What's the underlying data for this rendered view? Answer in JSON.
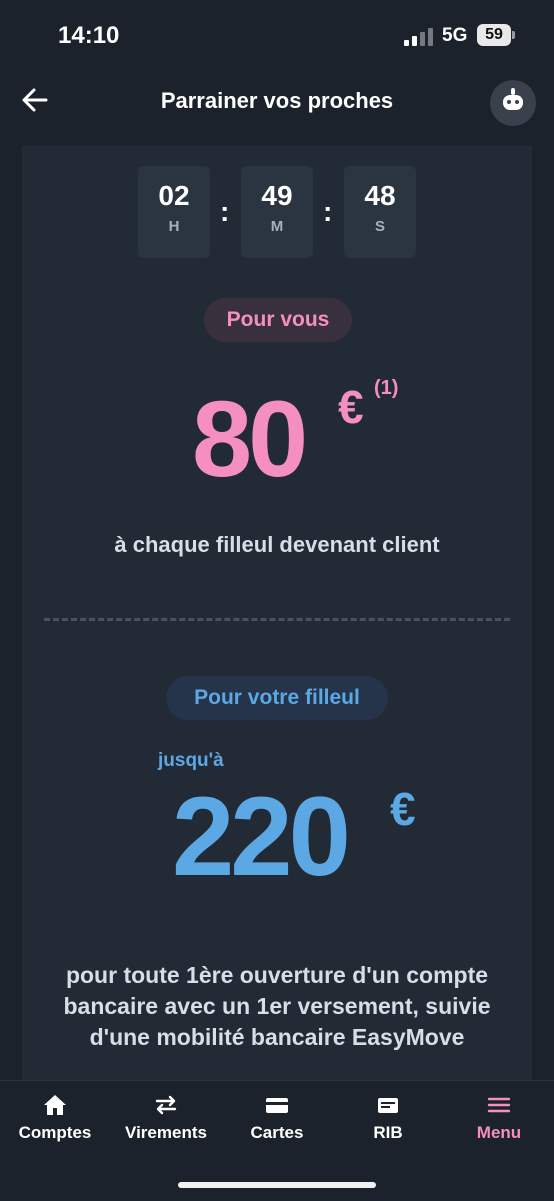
{
  "status_bar": {
    "time": "14:10",
    "network": "5G",
    "battery": "59"
  },
  "header": {
    "title": "Parrainer vos proches",
    "back_icon": "arrow-left-icon",
    "assistant_icon": "robot-icon"
  },
  "countdown": {
    "hours": {
      "value": "02",
      "unit": "H"
    },
    "minutes": {
      "value": "49",
      "unit": "M"
    },
    "seconds": {
      "value": "48",
      "unit": "S"
    },
    "separator": ":"
  },
  "referrer": {
    "pill": "Pour vous",
    "amount": "80",
    "currency": "€",
    "note": "(1)",
    "description": "à chaque filleul devenant client"
  },
  "referee": {
    "pill": "Pour votre filleul",
    "prefix": "jusqu'à",
    "amount": "220",
    "currency": "€",
    "description": "pour toute 1ère ouverture d'un compte bancaire avec un 1er versement, suivie d'une mobilité bancaire EasyMove"
  },
  "tabbar": {
    "items": [
      {
        "label": "Comptes",
        "icon": "home-icon"
      },
      {
        "label": "Virements",
        "icon": "transfer-icon"
      },
      {
        "label": "Cartes",
        "icon": "card-icon"
      },
      {
        "label": "RIB",
        "icon": "rib-icon"
      },
      {
        "label": "Menu",
        "icon": "menu-icon",
        "active": true
      }
    ]
  },
  "colors": {
    "pink": "#f48fbf",
    "blue": "#5ba8e4",
    "background": "#1c222b",
    "card": "#222a35"
  }
}
